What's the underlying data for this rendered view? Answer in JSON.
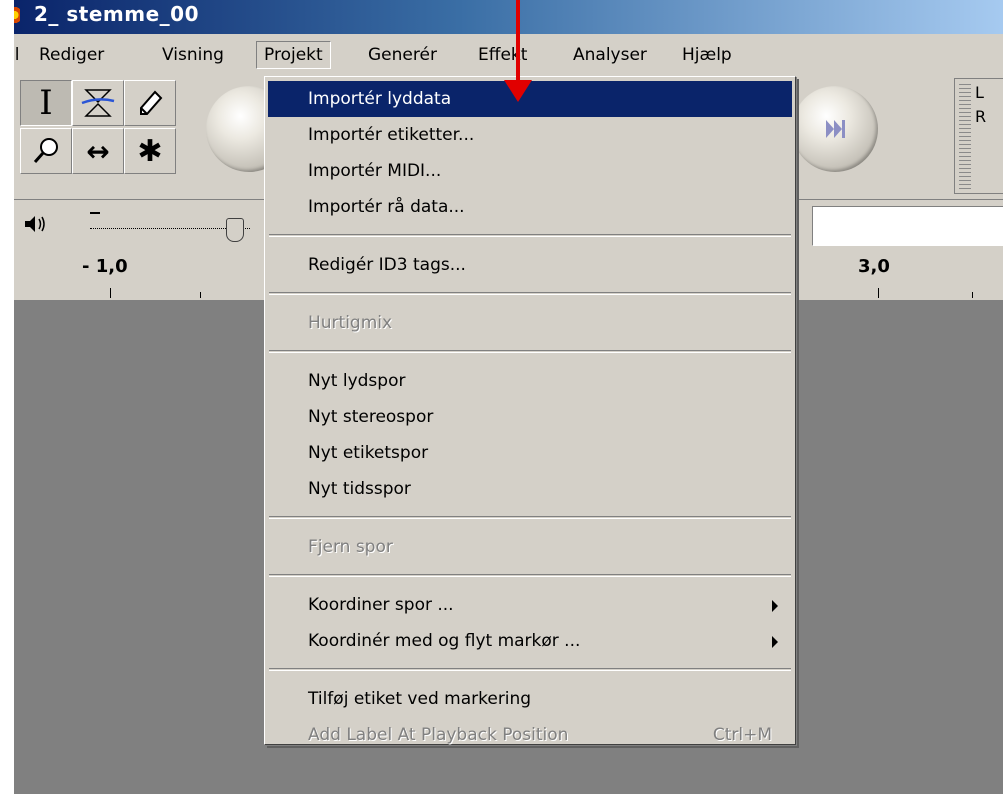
{
  "window": {
    "title": "2_ stemme_00"
  },
  "menubar": {
    "items": [
      {
        "label": "il"
      },
      {
        "label": "Rediger"
      },
      {
        "label": "Visning"
      },
      {
        "label": "Projekt"
      },
      {
        "label": "Generér"
      },
      {
        "label": "Effekt"
      },
      {
        "label": "Analyser"
      },
      {
        "label": "Hjælp"
      }
    ],
    "active": "Projekt"
  },
  "tools": {
    "selection": "I",
    "envelope": "envelope-icon",
    "draw": "pencil-icon",
    "zoom": "magnifier-icon",
    "timeshift": "↔",
    "multi": "✱"
  },
  "meter": {
    "left": "L",
    "right": "R"
  },
  "ruler": {
    "labels": [
      "- 1,0",
      "3,0"
    ]
  },
  "dropdown": {
    "groups": [
      [
        {
          "label": "Importér lyddata",
          "state": "selected"
        },
        {
          "label": "Importér etiketter...",
          "state": "enabled"
        },
        {
          "label": "Importér MIDI...",
          "state": "enabled"
        },
        {
          "label": "Importér rå data...",
          "state": "enabled"
        }
      ],
      [
        {
          "label": "Redigér ID3 tags...",
          "state": "enabled"
        }
      ],
      [
        {
          "label": "Hurtigmix",
          "state": "disabled"
        }
      ],
      [
        {
          "label": "Nyt lydspor",
          "state": "enabled"
        },
        {
          "label": "Nyt stereospor",
          "state": "enabled"
        },
        {
          "label": "Nyt etiketspor",
          "state": "enabled"
        },
        {
          "label": "Nyt tidsspor",
          "state": "enabled"
        }
      ],
      [
        {
          "label": "Fjern spor",
          "state": "disabled"
        }
      ],
      [
        {
          "label": "Koordiner spor ...",
          "state": "enabled",
          "submenu": true
        },
        {
          "label": "Koordinér med og flyt markør ...",
          "state": "enabled",
          "submenu": true
        }
      ],
      [
        {
          "label": "Tilføj etiket ved markering",
          "state": "enabled"
        },
        {
          "label": "Add Label At Playback Position",
          "state": "disabled",
          "shortcut": "Ctrl+M"
        }
      ]
    ]
  },
  "annotation": {
    "arrow_color": "#e10000"
  },
  "colors": {
    "highlight": "#0a246a",
    "face": "#d4d0c8",
    "workspace": "#808080"
  }
}
